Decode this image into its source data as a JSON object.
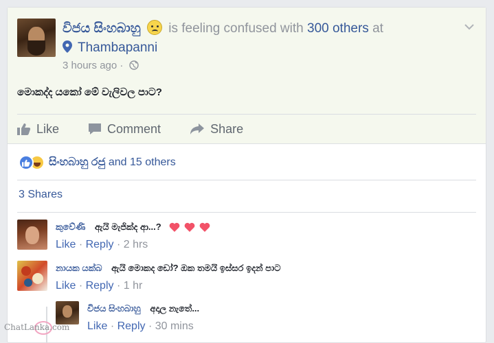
{
  "post": {
    "author": "විජය සිංහබාහු",
    "feeling_text": "is feeling confused with",
    "others_count": "300 others",
    "at": "at",
    "location": "Thambapanni",
    "time": "3 hours ago",
    "separator": "·",
    "text": "මොකද්ද යකෝ මේ වැලිවල පාට?"
  },
  "actions": {
    "like": "Like",
    "comment": "Comment",
    "share": "Share"
  },
  "reactions": {
    "names": "සිංහබාහු රජු",
    "others": "and 15 others"
  },
  "shares_label": "3 Shares",
  "comments": [
    {
      "author": "කුවේණි",
      "text": "ඇයි මැජික්ද ආ...?",
      "like": "Like",
      "reply": "Reply",
      "time": "2 hrs",
      "dot": "·"
    },
    {
      "author": "නායක යක්බ",
      "text": "ඇයි මොකද ඩෝ? ඔක තමයි ඉස්සර ඉදන් පාට",
      "like": "Like",
      "reply": "Reply",
      "time": "1 hr",
      "dot": "·"
    },
    {
      "author": "විජය සිංහබාහු",
      "text": "අදාල නැතේ...",
      "like": "Like",
      "reply": "Reply",
      "time": "30 mins",
      "dot": "·"
    }
  ],
  "watermark": "ChatLanka.com",
  "icons": {
    "chevron": "chevron-down-icon",
    "pin": "location-pin-icon",
    "globe": "globe-icon",
    "like": "thumbs-up-icon",
    "comment": "comment-bubble-icon",
    "share": "share-arrow-icon",
    "feeling": "confused-face-icon",
    "heart": "heart-icon"
  },
  "colors": {
    "link": "#365899",
    "muted": "#90949c",
    "action": "#606770",
    "heart": "#f25268",
    "post_bg": "#f5f8ee"
  }
}
